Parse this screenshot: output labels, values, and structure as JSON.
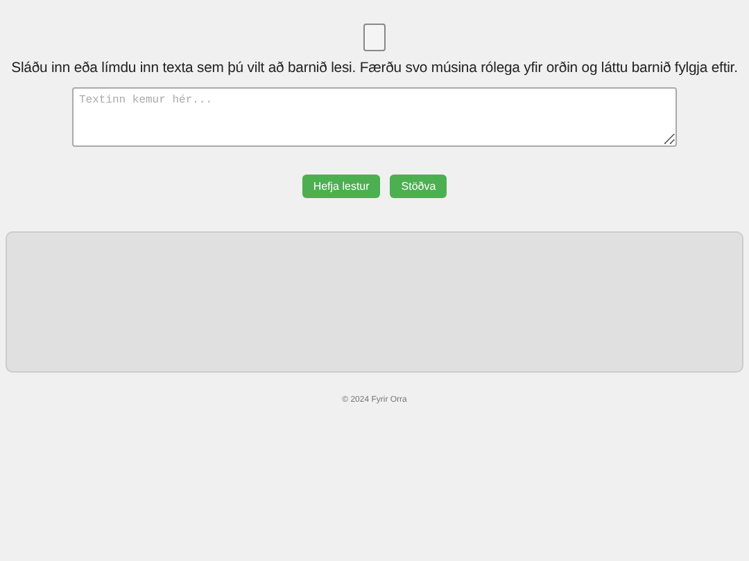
{
  "instructions": "Sláðu inn eða límdu inn texta sem þú vilt að barnið lesi. Færðu svo músina rólega yfir orðin og láttu barnið fylgja eftir.",
  "text_input": {
    "placeholder": "Textinn kemur hér..."
  },
  "buttons": [
    {
      "label": "Hefja lestur"
    },
    {
      "label": "Stöðva"
    }
  ],
  "footer": "© 2024 Fyrir Orra"
}
